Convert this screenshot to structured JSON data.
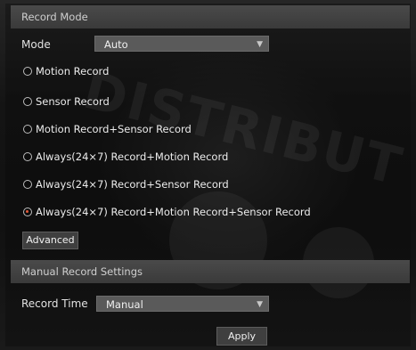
{
  "record_mode": {
    "header": "Record Mode",
    "mode_label": "Mode",
    "mode_value": "Auto",
    "options": [
      {
        "label": "Motion Record",
        "checked": false
      },
      {
        "label": "Sensor Record",
        "checked": false
      },
      {
        "label": "Motion Record+Sensor Record",
        "checked": false
      },
      {
        "label": "Always(24×7) Record+Motion Record",
        "checked": false
      },
      {
        "label": "Always(24×7) Record+Sensor Record",
        "checked": false
      },
      {
        "label": "Always(24×7) Record+Motion Record+Sensor Record",
        "checked": true
      }
    ],
    "advanced_label": "Advanced"
  },
  "manual_record": {
    "header": "Manual Record Settings",
    "record_time_label": "Record Time",
    "record_time_value": "Manual",
    "apply_label": "Apply"
  },
  "watermark": "DISTRIBUT",
  "colors": {
    "header_bg": "#414141",
    "select_bg": "#5a5a5a",
    "radio_checked": "#e35a3b"
  }
}
